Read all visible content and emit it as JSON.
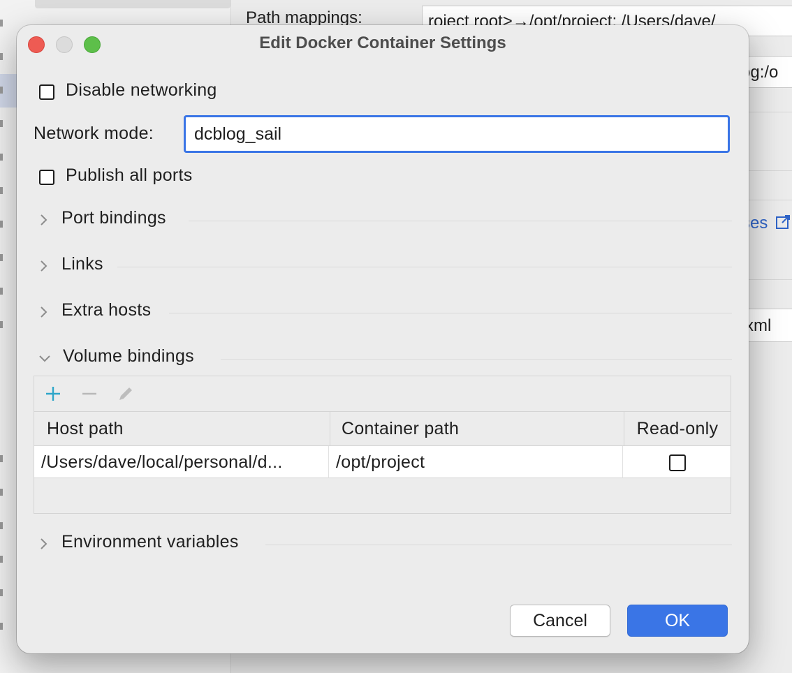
{
  "background": {
    "path_mappings_label": "Path mappings:",
    "path_mappings_value": "roject root>→/opt/project; /Users/dave/",
    "field2_value": "og:/o",
    "link_text": "ses",
    "field3_value": "xml"
  },
  "dialog": {
    "title": "Edit Docker Container Settings",
    "disable_networking_label": "Disable networking",
    "network_mode_label": "Network mode:",
    "network_mode_value": "dcblog_sail",
    "publish_all_ports_label": "Publish all ports",
    "sections": {
      "port_bindings": "Port bindings",
      "links": "Links",
      "extra_hosts": "Extra hosts",
      "volume_bindings": "Volume bindings",
      "environment_variables": "Environment variables"
    },
    "volume_table": {
      "headers": [
        "Host path",
        "Container path",
        "Read-only"
      ],
      "rows": [
        {
          "host_path": "/Users/dave/local/personal/d...",
          "container_path": "/opt/project",
          "read_only": false
        }
      ]
    },
    "buttons": {
      "cancel": "Cancel",
      "ok": "OK"
    }
  },
  "colors": {
    "accent": "#3a75e6",
    "close": "#ee5b53",
    "maximize": "#5dbf4a",
    "add_icon": "#2ea6c9"
  },
  "icons": [
    "add-icon",
    "remove-icon",
    "edit-icon",
    "chevron-right-icon",
    "chevron-down-icon"
  ]
}
